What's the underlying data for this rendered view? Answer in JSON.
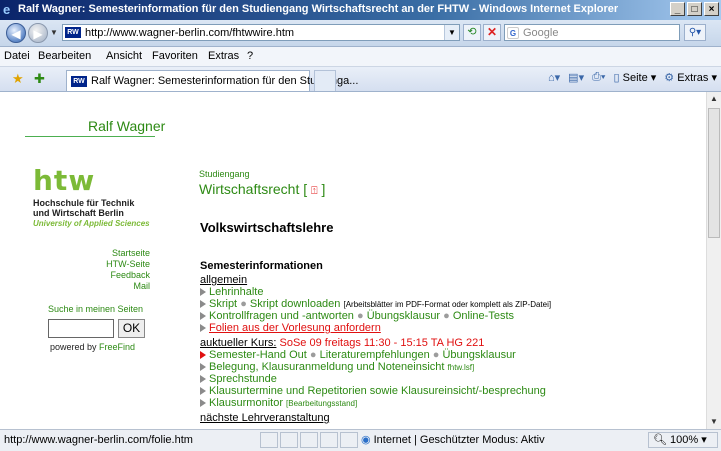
{
  "window": {
    "title": "Ralf Wagner: Semesterinformation für den Studiengang Wirtschaftsrecht an der FHTW - Windows Internet Explorer",
    "min": "_",
    "max": "□",
    "close": "×"
  },
  "address": {
    "favicon": "RW",
    "url": "http://www.wagner-berlin.com/fhtwwire.htm",
    "search_placeholder": "Google"
  },
  "menu": [
    "Datei",
    "Bearbeiten",
    "Ansicht",
    "Favoriten",
    "Extras",
    "?"
  ],
  "tab": {
    "title": "Ralf Wagner: Semesterinformation für den Studienga..."
  },
  "commands": {
    "page": "Seite",
    "tools": "Extras"
  },
  "page": {
    "author": "Ralf Wagner",
    "logo_text": "htw",
    "logo_sub1": "Hochschule für Technik",
    "logo_sub2": "und Wirtschaft Berlin",
    "logo_uas": "University of Applied Sciences",
    "side_links": [
      "Startseite",
      "HTW-Seite",
      "Feedback",
      "Mail"
    ],
    "search_label": "Suche in meinen Seiten",
    "search_button": "OK",
    "powered_prefix": "powered by",
    "powered_name": "FreeFind",
    "studiengang_label": "Studiengang",
    "studiengang_title": "Wirtschaftsrecht [",
    "studiengang_icon": "⍐",
    "studiengang_close": "]",
    "course_title": "Volkswirtschaftslehre",
    "semester_heading": "Semesterinformationen",
    "allgemein": "allgemein",
    "lehrinhalte": "Lehrinhalte",
    "skript": "Skript",
    "skript_download": "Skript downloaden",
    "skript_note": "[Arbeitsblätter im PDF-Format oder komplett als ZIP-Datei]",
    "kontroll": "Kontrollfragen und -antworten",
    "uebungsklausur": "Übungsklausur",
    "online_tests": "Online-Tests",
    "folien": "Folien aus der Vorlesung anfordern",
    "aktueller_kurs": "auktueller Kurs:",
    "kurs_info": "SoSe 09 freitags 11:30 - 15:15 TA HG 221",
    "semester_handout": "Semester-Hand Out",
    "literatur": "Literaturempfehlungen",
    "uebungsklausur2": "Übungsklausur",
    "belegung": "Belegung, Klausuranmeldung und Noteneinsicht",
    "belegung_note": "fhtw.lsf]",
    "sprechstunde": "Sprechstunde",
    "klausurtermine": "Klausurtermine und Repetitorien sowie Klausureinsicht/-besprechung",
    "klausurmonitor": "Klausurmonitor",
    "klausurmonitor_note": "[Bearbeitungsstand]",
    "naechste": "nächste Lehrveranstaltung"
  },
  "status": {
    "text": "http://www.wagner-berlin.com/folie.htm",
    "zone": "Internet | Geschützter Modus: Aktiv",
    "zoom": "100%"
  }
}
